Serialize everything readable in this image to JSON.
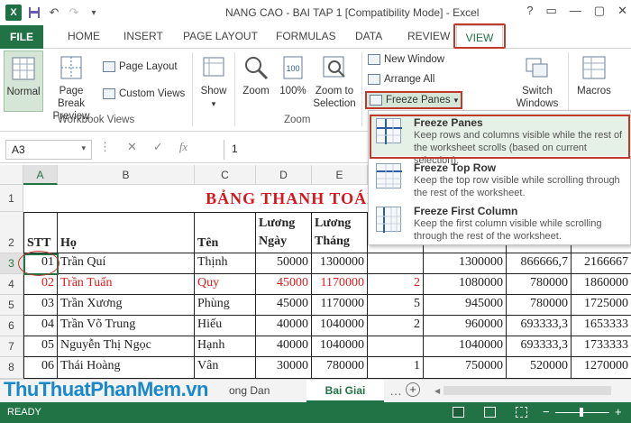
{
  "window": {
    "title": "NANG CAO - BAI TAP 1  [Compatibility Mode] - Excel",
    "controls": [
      "?",
      "▭",
      "—",
      "▢",
      "✕"
    ]
  },
  "tabs": [
    "FILE",
    "HOME",
    "INSERT",
    "PAGE LAYOUT",
    "FORMULAS",
    "DATA",
    "REVIEW",
    "VIEW"
  ],
  "ribbon": {
    "workbook_views": {
      "normal": "Normal",
      "page_break": [
        "Page Break",
        "Preview"
      ],
      "page_layout": "Page Layout",
      "custom_views": "Custom Views",
      "group_label": "Workbook Views"
    },
    "show": "Show",
    "zoom": {
      "zoom": "Zoom",
      "hundred": "100%",
      "to_selection": [
        "Zoom to",
        "Selection"
      ],
      "group_label": "Zoom"
    },
    "window": {
      "new_window": "New Window",
      "arrange_all": "Arrange All",
      "freeze_panes": "Freeze Panes",
      "switch": [
        "Switch",
        "Windows"
      ],
      "macros": "Macros"
    }
  },
  "formula_bar": {
    "name_box": "A3",
    "value": "1"
  },
  "freeze_menu": [
    {
      "title": "Freeze Panes",
      "desc": [
        "Keep rows and columns visible while the rest of",
        "the worksheet scrolls (based on current selection)."
      ]
    },
    {
      "title": "Freeze Top Row",
      "desc": [
        "Keep the top row visible while scrolling through",
        "the rest of the worksheet."
      ]
    },
    {
      "title": "Freeze First Column",
      "desc": [
        "Keep the first column visible while scrolling",
        "through the rest of the worksheet."
      ]
    }
  ],
  "sheet": {
    "col_letters": [
      "A",
      "B",
      "C",
      "D",
      "E"
    ],
    "row_numbers": [
      "1",
      "2",
      "3",
      "4",
      "5",
      "6",
      "7",
      "8"
    ],
    "title": "BẢNG THANH TOÁN LƯƠNG",
    "headers": {
      "stt": "STT",
      "ho": "Họ",
      "ten": "Tên",
      "luong_ngay": [
        "Lương",
        "Ngày"
      ],
      "luong_thang": [
        "Lương",
        "Tháng"
      ]
    },
    "rows": [
      {
        "stt": "01",
        "ho": "Trần Quí",
        "ten": "Thịnh",
        "ngay": "50000",
        "thang": "1300000",
        "g": "",
        "h": "1300000",
        "i": "866666,7",
        "j": "2166667",
        "red": false
      },
      {
        "stt": "02",
        "ho": "Trần Tuấn",
        "ten": "Quy",
        "ngay": "45000",
        "thang": "1170000",
        "g": "2",
        "h": "1080000",
        "i": "780000",
        "j": "1860000",
        "red": true
      },
      {
        "stt": "03",
        "ho": "Trần Xương",
        "ten": "Phùng",
        "ngay": "45000",
        "thang": "1170000",
        "g": "5",
        "h": "945000",
        "i": "780000",
        "j": "1725000",
        "red": false
      },
      {
        "stt": "04",
        "ho": "Trần Võ Trung",
        "ten": "Hiếu",
        "ngay": "40000",
        "thang": "1040000",
        "g": "2",
        "h": "960000",
        "i": "693333,3",
        "j": "1653333",
        "red": false
      },
      {
        "stt": "05",
        "ho": "Nguyễn Thị Ngọc",
        "ten": "Hạnh",
        "ngay": "40000",
        "thang": "1040000",
        "g": "",
        "h": "1040000",
        "i": "693333,3",
        "j": "1733333",
        "red": false
      },
      {
        "stt": "06",
        "ho": "Thái Hoàng",
        "ten": "Vân",
        "ngay": "30000",
        "thang": "780000",
        "g": "1",
        "h": "750000",
        "i": "520000",
        "j": "1270000",
        "red": false
      }
    ]
  },
  "sheet_tabs": {
    "first": "ong Dan",
    "active": "Bai Giai"
  },
  "watermark": "ThuThuatPhanMem.vn",
  "status": "READY"
}
